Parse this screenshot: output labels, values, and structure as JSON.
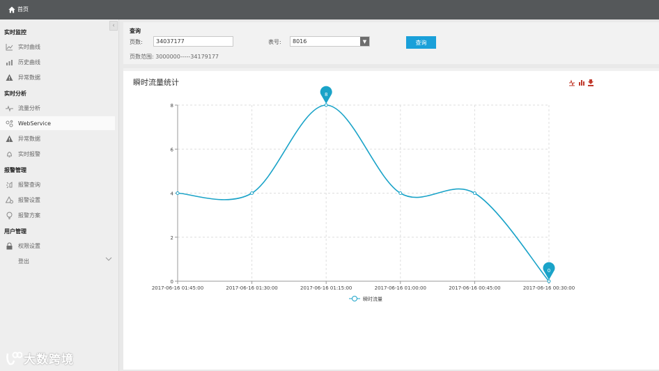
{
  "header": {
    "home_label": "首页"
  },
  "sidebar": {
    "sections": [
      {
        "title": "实时监控",
        "items": [
          {
            "label": "实时曲线",
            "icon": "line-chart-icon",
            "active": false
          },
          {
            "label": "历史曲线",
            "icon": "bar-chart-icon",
            "active": false
          },
          {
            "label": "异常数据",
            "icon": "warning-icon",
            "active": false
          }
        ]
      },
      {
        "title": "实时分析",
        "items": [
          {
            "label": "流量分析",
            "icon": "pulse-icon",
            "active": false
          },
          {
            "label": "WebService",
            "icon": "network-icon",
            "active": true
          },
          {
            "label": "异常数据",
            "icon": "warning-icon",
            "active": false
          },
          {
            "label": "实时报警",
            "icon": "bell-icon",
            "active": false
          }
        ]
      },
      {
        "title": "报警管理",
        "items": [
          {
            "label": "报警查询",
            "icon": "alarm-query-icon",
            "active": false
          },
          {
            "label": "报警设置",
            "icon": "alarm-settings-icon",
            "active": false
          },
          {
            "label": "报警方案",
            "icon": "lightbulb-icon",
            "active": false
          }
        ]
      },
      {
        "title": "用户管理",
        "items": [
          {
            "label": "权限设置",
            "icon": "lock-icon",
            "active": false
          },
          {
            "label": "登出",
            "icon": "",
            "active": false
          }
        ]
      }
    ],
    "watermark": "大数跨境"
  },
  "query": {
    "title": "查询",
    "page_label": "页数:",
    "page_value": "34037177",
    "meter_label": "表号:",
    "meter_value": "8016",
    "button_label": "查询",
    "range_text": "页数范围: 3000000-----34179177"
  },
  "chart_data": {
    "type": "line",
    "title": "瞬时流量统计",
    "categories": [
      "2017-06-16 01:45:00",
      "2017-06-16 01:30:00",
      "2017-06-16 01:15:00",
      "2017-06-16 01:00:00",
      "2017-06-16 00:45:00",
      "2017-06-16 00:30:00"
    ],
    "series": [
      {
        "name": "瞬时流量",
        "values": [
          4,
          4,
          8,
          4,
          4,
          0
        ],
        "color": "#1aa3c8"
      }
    ],
    "ylim": [
      0,
      8
    ],
    "yticks": [
      0,
      2,
      4,
      6,
      8
    ],
    "markers": [
      {
        "label": "8",
        "index": 2
      },
      {
        "label": "0",
        "index": 5
      }
    ],
    "grid": true,
    "legend": "bottom-center",
    "toolbox": [
      "line-switch-icon",
      "bar-switch-icon",
      "download-icon"
    ],
    "toolbox_colors": [
      "#c0392b",
      "#c0392b",
      "#c0392b"
    ]
  }
}
